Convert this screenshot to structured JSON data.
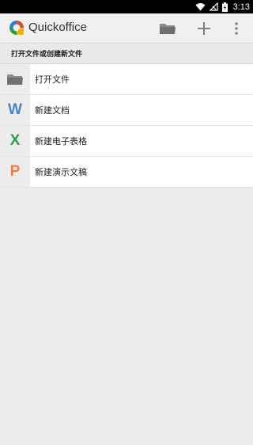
{
  "status_bar": {
    "time": "3:13"
  },
  "app_bar": {
    "title": "Quickoffice",
    "brand_colors": {
      "blue": "#2f7bd9",
      "red": "#e0453a",
      "yellow": "#f5b400",
      "green": "#2a9d4a"
    }
  },
  "section": {
    "title": "打开文件或创建新文件"
  },
  "items": [
    {
      "icon": "folder-icon",
      "label": "打开文件",
      "color": "#707070"
    },
    {
      "icon": "word-document-icon",
      "letter": "W",
      "label": "新建文档",
      "color": "#4a86c5"
    },
    {
      "icon": "excel-spreadsheet-icon",
      "letter": "X",
      "label": "新建电子表格",
      "color": "#2e9a55"
    },
    {
      "icon": "powerpoint-presentation-icon",
      "letter": "P",
      "label": "新建演示文稿",
      "color": "#ef7b3f"
    }
  ]
}
